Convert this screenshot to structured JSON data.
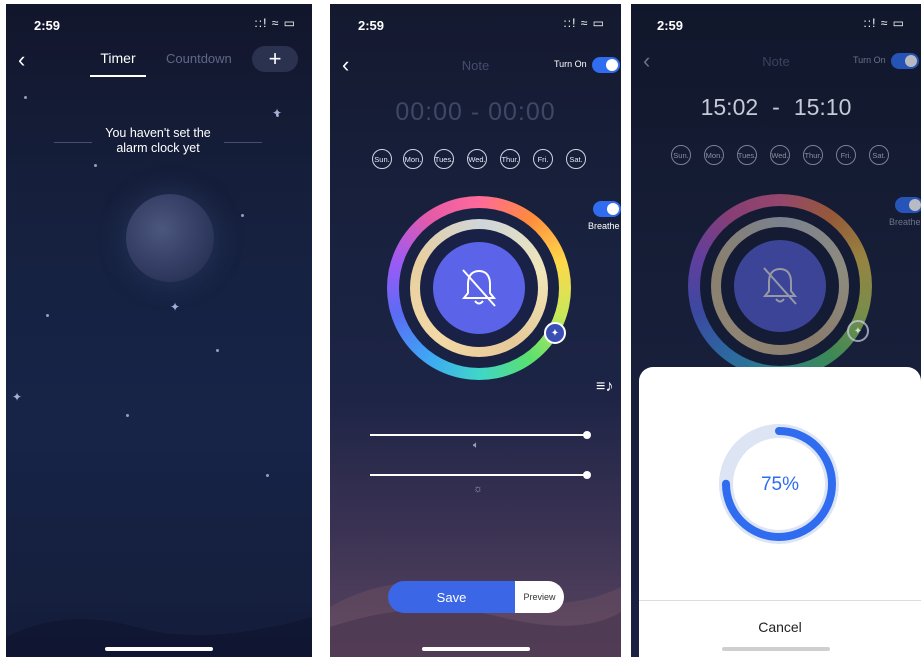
{
  "screen1": {
    "status_time": "2:59",
    "status_icons": "::! ≈ ▭",
    "tabs": [
      {
        "label": "Timer"
      },
      {
        "label": "Countdown"
      }
    ],
    "add_label": "+",
    "empty_message_line1": "You haven't set the",
    "empty_message_line2": "alarm clock yet"
  },
  "screen2": {
    "status_time": "2:59",
    "status_icons": "::! ≈ ▭",
    "title": "Note",
    "turn_on_label": "Turn On",
    "time_range": "00:00 - 00:00",
    "days": [
      {
        "label": "Sun."
      },
      {
        "label": "Mon."
      },
      {
        "label": "Tues."
      },
      {
        "label": "Wed."
      },
      {
        "label": "Thur."
      },
      {
        "label": "Fri."
      },
      {
        "label": "Sat."
      }
    ],
    "breathe_label": "Breathe",
    "volume_level": 1.0,
    "brightness_level": 1.0,
    "save_label": "Save",
    "preview_label": "Preview"
  },
  "screen3": {
    "status_time": "2:59",
    "status_icons": "::! ≈ ▭",
    "title": "Note",
    "turn_on_label": "Turn On",
    "time_start": "15:02",
    "time_sep": "-",
    "time_end": "15:10",
    "days": [
      {
        "label": "Sun."
      },
      {
        "label": "Mon."
      },
      {
        "label": "Tues."
      },
      {
        "label": "Wed."
      },
      {
        "label": "Thur."
      },
      {
        "label": "Fri."
      },
      {
        "label": "Sat."
      }
    ],
    "breathe_label": "Breathe",
    "progress_value": 0.75,
    "progress_label": "75%",
    "cancel_label": "Cancel"
  },
  "colors": {
    "accent": "#2f6cf0",
    "bell_fill": "#5b64e8",
    "progress_track": "#dde4f4"
  }
}
